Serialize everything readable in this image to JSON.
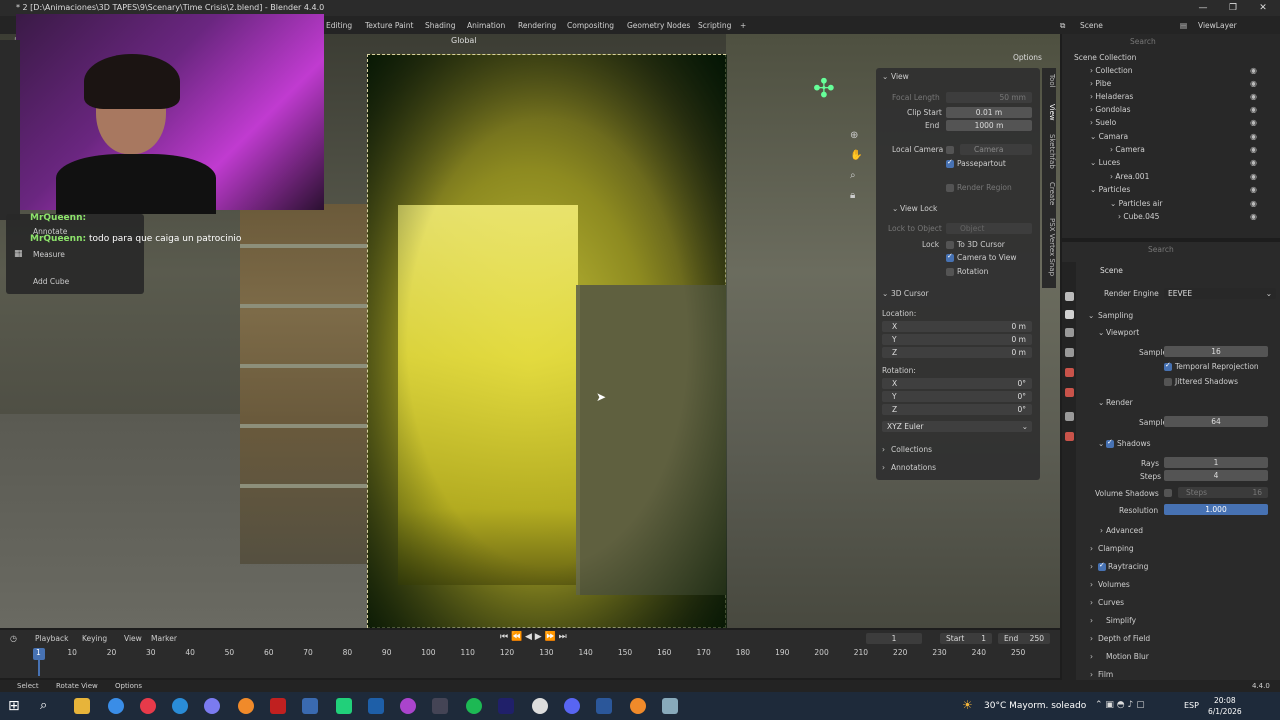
{
  "window": {
    "title": "* 2 [D:\\Animaciones\\3D TAPES\\9\\Scenary\\Time Crisis\\2.blend] - Blender 4.4.0"
  },
  "workspaces": [
    "Editing",
    "Texture Paint",
    "Shading",
    "Animation",
    "Rendering",
    "Compositing",
    "Geometry Nodes",
    "Scripting",
    "+"
  ],
  "header": {
    "transform": "Global",
    "scene": "Scene",
    "view_layer": "ViewLayer",
    "options": "Options",
    "search_placeholder": "Search"
  },
  "chat": {
    "user": "MrQueenn:",
    "message": "todo para que caiga un patrocinio"
  },
  "tool_menu": {
    "annotate": "Annotate",
    "measure": "Measure",
    "add_cube": "Add Cube"
  },
  "npanel": {
    "tabs": [
      "Tool",
      "View",
      "Sketchfab",
      "Create",
      "PSX Vertex Snap"
    ],
    "view_header": "View",
    "focal_length": {
      "label": "Focal Length",
      "value": "50 mm"
    },
    "clip_start": {
      "label": "Clip Start",
      "value": "0.01 m"
    },
    "end": {
      "label": "End",
      "value": "1000 m"
    },
    "local_camera": {
      "label": "Local Camera",
      "value": "Camera"
    },
    "passepartout": "Passepartout",
    "render_region": "Render Region",
    "view_lock_header": "View Lock",
    "lock_to_object": {
      "label": "Lock to Object",
      "value": "Object"
    },
    "lock": "Lock",
    "to_3d_cursor": "To 3D Cursor",
    "camera_to_view": "Camera to View",
    "rotation": "Rotation",
    "cursor_header": "3D Cursor",
    "location_label": "Location:",
    "loc": [
      {
        "axis": "X",
        "value": "0 m"
      },
      {
        "axis": "Y",
        "value": "0 m"
      },
      {
        "axis": "Z",
        "value": "0 m"
      }
    ],
    "rotation_label": "Rotation:",
    "rot": [
      {
        "axis": "X",
        "value": "0°"
      },
      {
        "axis": "Y",
        "value": "0°"
      },
      {
        "axis": "Z",
        "value": "0°"
      }
    ],
    "euler": "XYZ Euler",
    "collections": "Collections",
    "annotations": "Annotations"
  },
  "outliner": {
    "root": "Scene Collection",
    "rows": [
      "Collection",
      "Pibe",
      "Heladeras",
      "Gondolas",
      "Suelo",
      "Camara",
      "Camera",
      "Luces",
      "Area.001",
      "Particles",
      "Particles air",
      "Cube.045"
    ]
  },
  "properties": {
    "scene": "Scene",
    "render_engine": {
      "label": "Render Engine",
      "value": "EEVEE"
    },
    "sampling": "Sampling",
    "viewport": "Viewport",
    "vp_samples": {
      "label": "Samples",
      "value": "16"
    },
    "temporal_reprojection": "Temporal Reprojection",
    "jittered_shadows": "Jittered Shadows",
    "render": "Render",
    "r_samples": {
      "label": "Samples",
      "value": "64"
    },
    "shadows": "Shadows",
    "rays": {
      "label": "Rays",
      "value": "1"
    },
    "steps": {
      "label": "Steps",
      "value": "4"
    },
    "volume_shadows": {
      "label": "Volume Shadows",
      "steps_label": "Steps",
      "value": "16"
    },
    "resolution": {
      "label": "Resolution",
      "value": "1.000"
    },
    "sections": [
      "Advanced",
      "Clamping",
      "Raytracing",
      "Volumes",
      "Curves",
      "Simplify",
      "Depth of Field",
      "Motion Blur",
      "Film"
    ]
  },
  "timeline": {
    "menus": [
      "Playback",
      "Keying",
      "View",
      "Marker"
    ],
    "current_frame": "1",
    "start": {
      "label": "Start",
      "value": "1"
    },
    "end": {
      "label": "End",
      "value": "250"
    },
    "ticks": [
      "1",
      "10",
      "20",
      "30",
      "40",
      "50",
      "60",
      "70",
      "80",
      "90",
      "100",
      "110",
      "120",
      "130",
      "140",
      "150",
      "160",
      "170",
      "180",
      "190",
      "200",
      "210",
      "220",
      "230",
      "240",
      "250"
    ]
  },
  "statusbar": {
    "select": "Select",
    "rotate_view": "Rotate View",
    "options": "Options",
    "version": "4.4.0"
  },
  "taskbar": {
    "weather": "30°C  Mayorm. soleado",
    "lang": "ESP",
    "time": "20:08",
    "date": "6/1/2026"
  }
}
